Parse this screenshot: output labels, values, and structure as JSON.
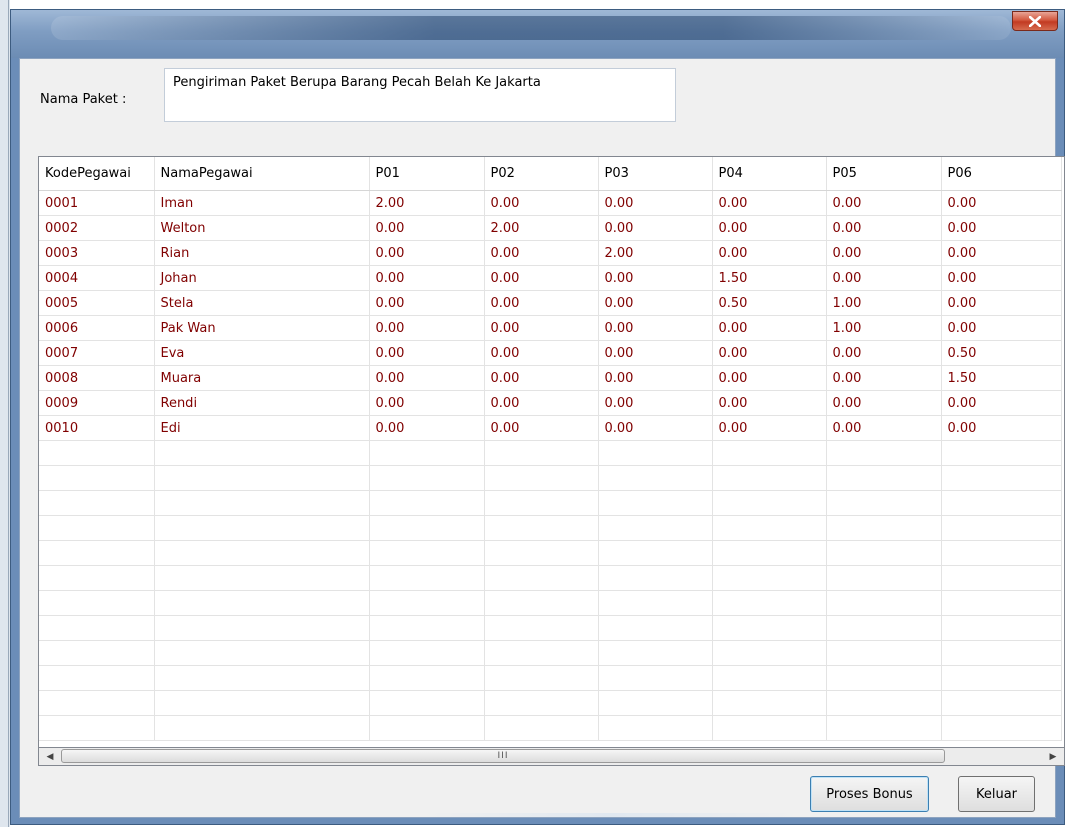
{
  "window": {
    "close_label": "x"
  },
  "form": {
    "nama_paket_label": "Nama Paket :",
    "nama_paket_value": "Pengiriman Paket Berupa Barang Pecah Belah Ke Jakarta"
  },
  "grid": {
    "columns": [
      "KodePegawai",
      "NamaPegawai",
      "P01",
      "P02",
      "P03",
      "P04",
      "P05",
      "P06"
    ],
    "rows": [
      [
        "0001",
        "Iman",
        "2.00",
        "0.00",
        "0.00",
        "0.00",
        "0.00",
        "0.00"
      ],
      [
        "0002",
        "Welton",
        "0.00",
        "2.00",
        "0.00",
        "0.00",
        "0.00",
        "0.00"
      ],
      [
        "0003",
        "Rian",
        "0.00",
        "0.00",
        "2.00",
        "0.00",
        "0.00",
        "0.00"
      ],
      [
        "0004",
        "Johan",
        "0.00",
        "0.00",
        "0.00",
        "1.50",
        "0.00",
        "0.00"
      ],
      [
        "0005",
        "Stela",
        "0.00",
        "0.00",
        "0.00",
        "0.50",
        "1.00",
        "0.00"
      ],
      [
        "0006",
        "Pak Wan",
        "0.00",
        "0.00",
        "0.00",
        "0.00",
        "1.00",
        "0.00"
      ],
      [
        "0007",
        "Eva",
        "0.00",
        "0.00",
        "0.00",
        "0.00",
        "0.00",
        "0.50"
      ],
      [
        "0008",
        "Muara",
        "0.00",
        "0.00",
        "0.00",
        "0.00",
        "0.00",
        "1.50"
      ],
      [
        "0009",
        "Rendi",
        "0.00",
        "0.00",
        "0.00",
        "0.00",
        "0.00",
        "0.00"
      ],
      [
        "0010",
        "Edi",
        "0.00",
        "0.00",
        "0.00",
        "0.00",
        "0.00",
        "0.00"
      ]
    ],
    "empty_rows": 12
  },
  "scrollbar": {
    "thumb_grip": "III"
  },
  "buttons": {
    "proses_label": "Proses Bonus",
    "keluar_label": "Keluar"
  },
  "colors": {
    "cell_text": "#800000",
    "title_bar": "#6b8db8",
    "close_button": "#c23b22"
  }
}
